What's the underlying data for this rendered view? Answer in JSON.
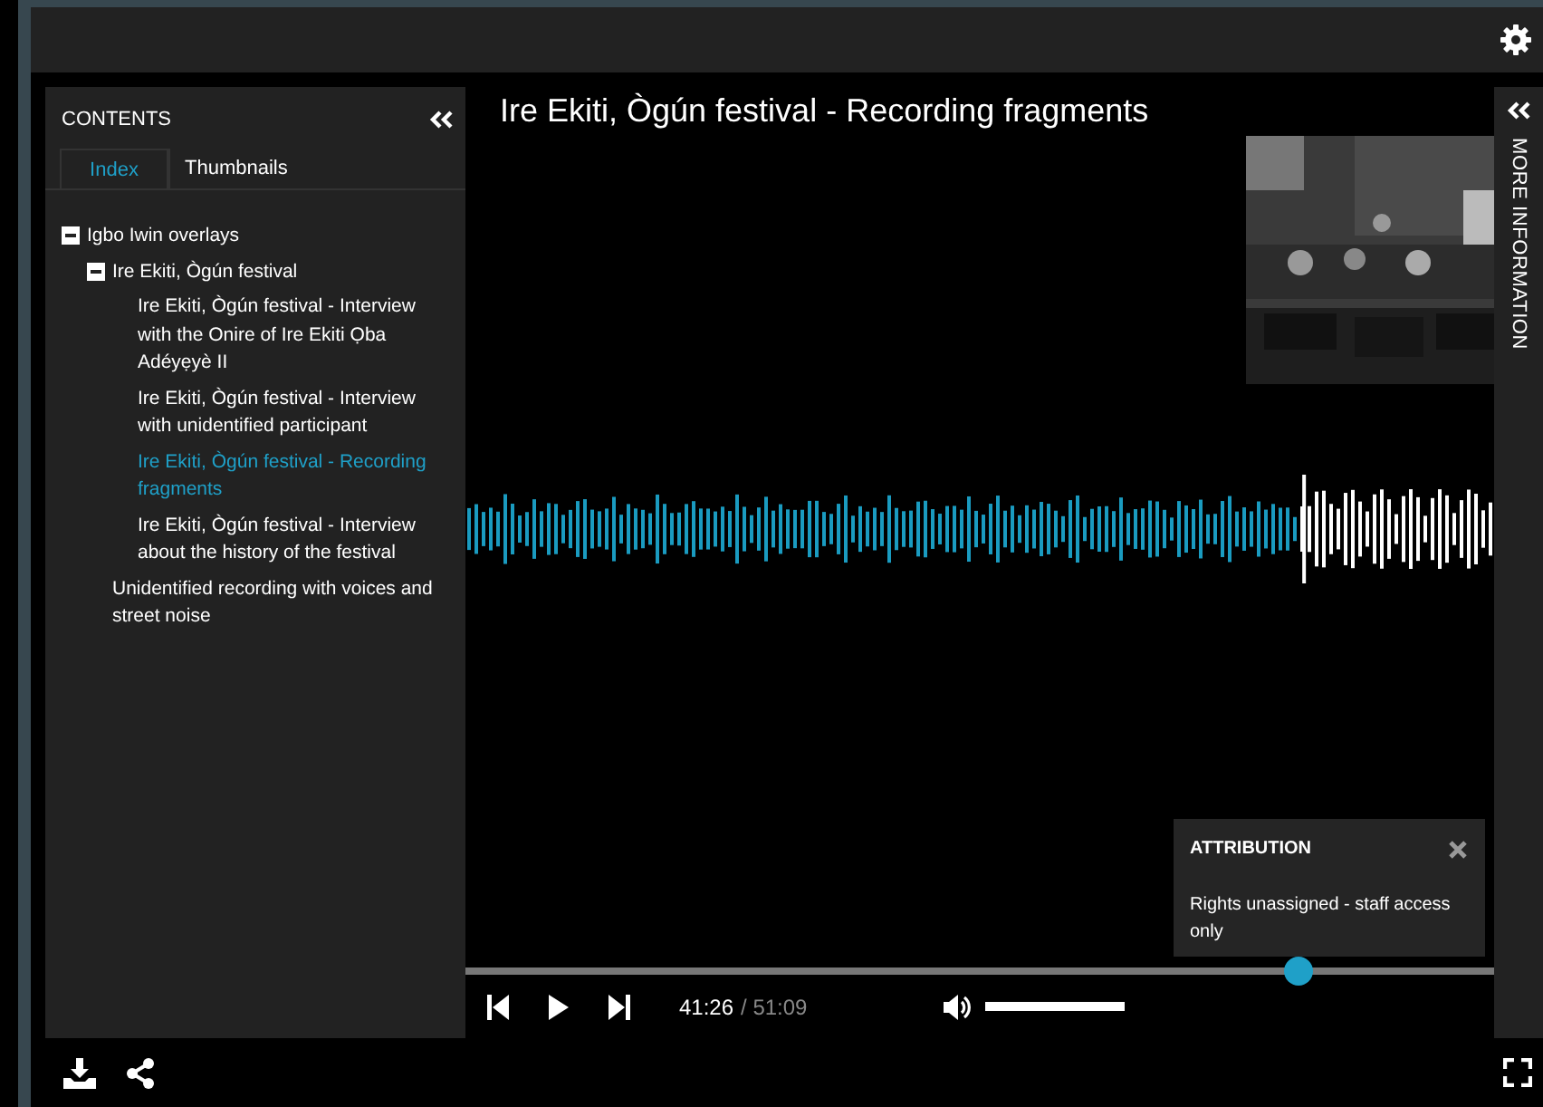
{
  "contents_panel": {
    "title": "CONTENTS",
    "tabs": [
      {
        "label": "Index",
        "selected": true
      },
      {
        "label": "Thumbnails",
        "selected": false
      }
    ],
    "tree": [
      {
        "label": "Igbo Iwin overlays",
        "expanded": true,
        "selected": false,
        "children": [
          {
            "label": "Ire Ekiti, Ògún festival",
            "expanded": true,
            "selected": false,
            "children": [
              {
                "label": "Ire Ekiti, Ògún festival - Interview with the Onire of Ire Ekiti Ọba Adéyẹyè II",
                "selected": false
              },
              {
                "label": "Ire Ekiti, Ògún festival - Interview with unidentified participant",
                "selected": false
              },
              {
                "label": "Ire Ekiti, Ògún festival - Recording fragments",
                "selected": true
              },
              {
                "label": "Ire Ekiti, Ògún festival - Interview about the history of the festival",
                "selected": false
              }
            ]
          },
          {
            "label": "Unidentified recording with voices and street noise",
            "selected": false
          }
        ]
      }
    ]
  },
  "player": {
    "title": "Ire Ekiti, Ògún festival - Recording fragments",
    "scrubber": {
      "level": 0.81
    },
    "current_time": "41:26",
    "duration": "/ 51:09",
    "volume": {
      "level": 1
    }
  },
  "more_information": {
    "title": "MORE INFORMATION"
  },
  "attribution": {
    "title": "ATTRIBUTION",
    "text": "Rights unassigned - staff access only"
  }
}
